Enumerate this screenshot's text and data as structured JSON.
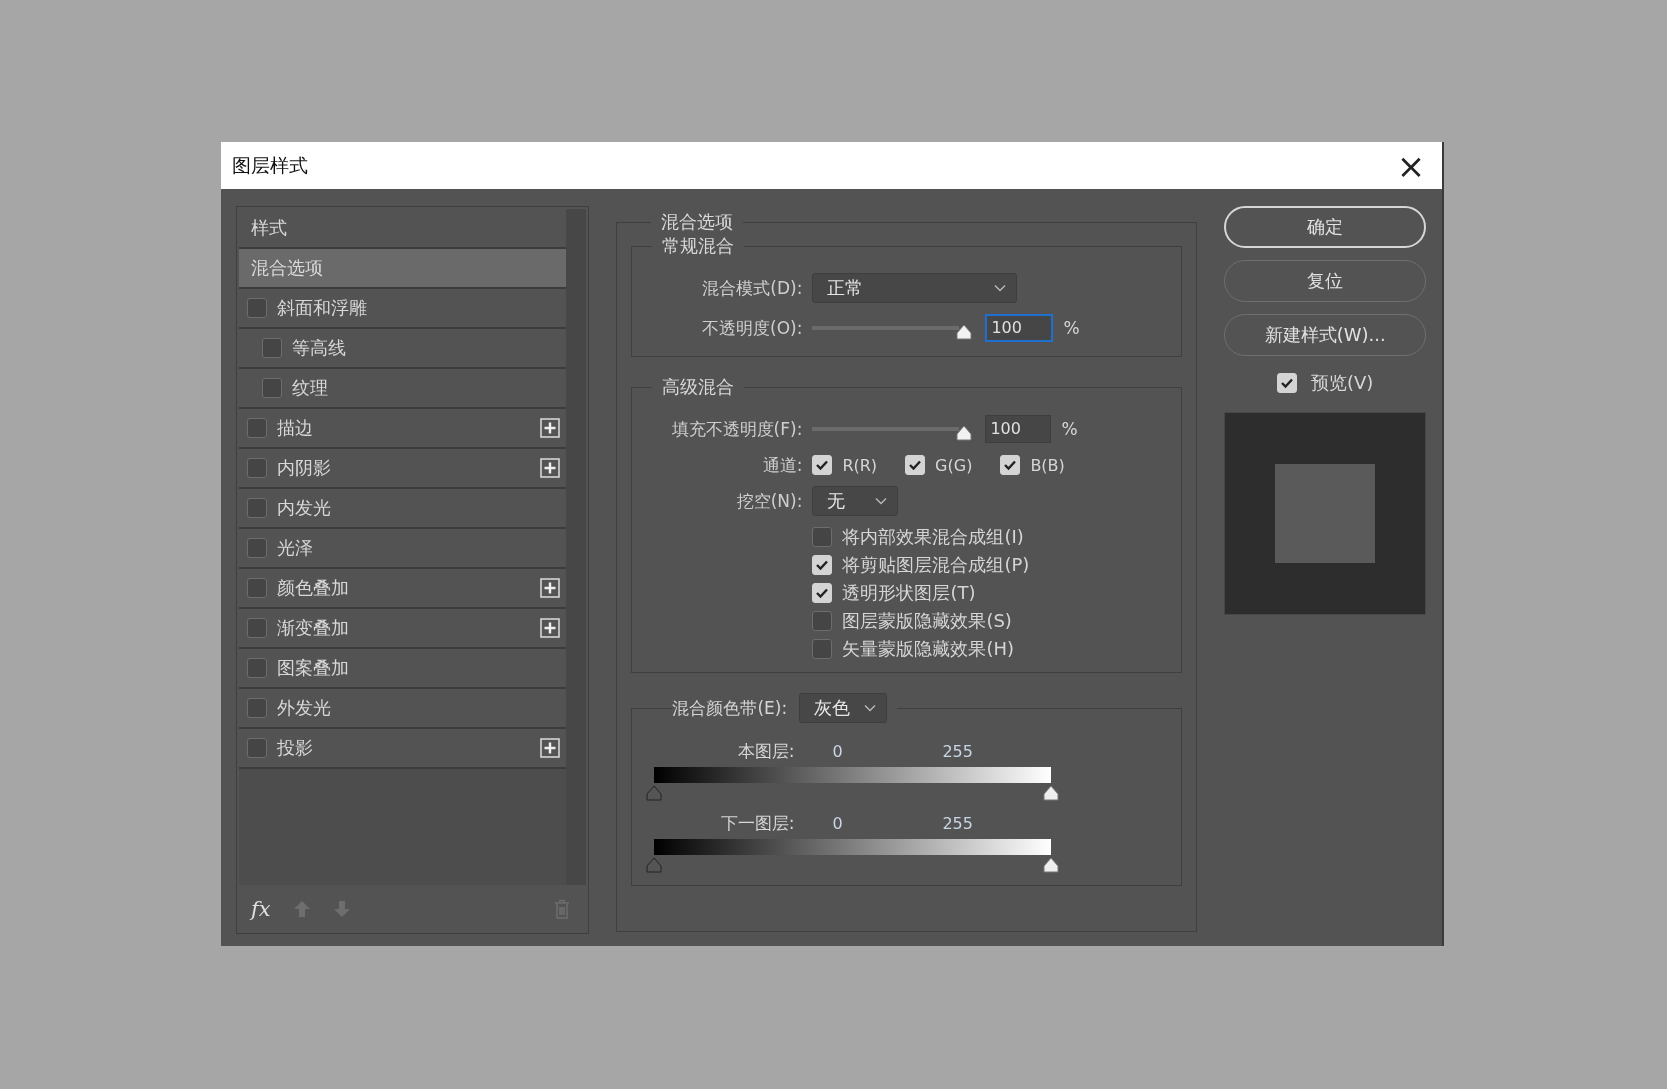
{
  "window": {
    "title": "图层样式",
    "close": "×"
  },
  "styles_panel": {
    "items": [
      {
        "kind": "header",
        "label": "样式",
        "selected": false
      },
      {
        "kind": "section",
        "label": "混合选项",
        "selected": true
      },
      {
        "kind": "effect",
        "label": "斜面和浮雕",
        "checked": false,
        "addable": false,
        "children": [
          {
            "kind": "effect",
            "label": "等高线",
            "checked": false,
            "addable": false
          },
          {
            "kind": "effect",
            "label": "纹理",
            "checked": false,
            "addable": false
          }
        ]
      },
      {
        "kind": "effect",
        "label": "描边",
        "checked": false,
        "addable": true
      },
      {
        "kind": "effect",
        "label": "内阴影",
        "checked": false,
        "addable": true
      },
      {
        "kind": "effect",
        "label": "内发光",
        "checked": false,
        "addable": false
      },
      {
        "kind": "effect",
        "label": "光泽",
        "checked": false,
        "addable": false
      },
      {
        "kind": "effect",
        "label": "颜色叠加",
        "checked": false,
        "addable": true
      },
      {
        "kind": "effect",
        "label": "渐变叠加",
        "checked": false,
        "addable": true
      },
      {
        "kind": "effect",
        "label": "图案叠加",
        "checked": false,
        "addable": false
      },
      {
        "kind": "effect",
        "label": "外发光",
        "checked": false,
        "addable": false
      },
      {
        "kind": "effect",
        "label": "投影",
        "checked": false,
        "addable": true
      }
    ],
    "footer": {
      "fx": "fx"
    }
  },
  "blending_options": {
    "title": "混合选项",
    "general": {
      "title": "常规混合",
      "mode_label": "混合模式(D):",
      "mode_value": "正常",
      "opacity": {
        "label": "不透明度(O):",
        "level": 1,
        "value": "100",
        "unit": "%"
      }
    },
    "advanced": {
      "title": "高级混合",
      "fill": {
        "label": "填充不透明度(F):",
        "level": 1,
        "value": "100",
        "unit": "%"
      },
      "channels_label": "通道:",
      "channels": [
        {
          "label": "R(R)",
          "checked": true
        },
        {
          "label": "G(G)",
          "checked": true
        },
        {
          "label": "B(B)",
          "checked": true
        }
      ],
      "knockout_label": "挖空(N):",
      "knockout_value": "无",
      "options": [
        {
          "label": "将内部效果混合成组(I)",
          "checked": false
        },
        {
          "label": "将剪贴图层混合成组(P)",
          "checked": true
        },
        {
          "label": "透明形状图层(T)",
          "checked": true
        },
        {
          "label": "图层蒙版隐藏效果(S)",
          "checked": false
        },
        {
          "label": "矢量蒙版隐藏效果(H)",
          "checked": false
        }
      ]
    },
    "blend_if": {
      "label": "混合颜色带(E):",
      "value": "灰色",
      "bands": [
        {
          "label": "本图层:",
          "low": "0",
          "high": "255"
        },
        {
          "label": "下一图层:",
          "low": "0",
          "high": "255"
        }
      ]
    }
  },
  "buttons": [
    {
      "label": "确定",
      "default": true
    },
    {
      "label": "复位",
      "default": false
    },
    {
      "label": "新建样式(W)...",
      "default": false
    }
  ],
  "preview": {
    "label": "预览(V)",
    "checked": true
  }
}
